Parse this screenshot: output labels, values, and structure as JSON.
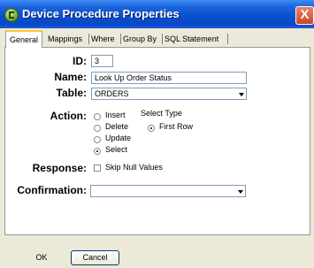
{
  "window": {
    "title": "Device Procedure Properties",
    "close_glyph": "X",
    "titlebar_color": "#0a4fd0",
    "icon": "green-c-icon"
  },
  "tabs": [
    {
      "label": "General",
      "active": true
    },
    {
      "label": "Mappings",
      "active": false
    },
    {
      "label": "Where",
      "active": false
    },
    {
      "label": "Group By",
      "active": false
    },
    {
      "label": "SQL Statement",
      "active": false
    }
  ],
  "form": {
    "id_label": "ID:",
    "id_value": "3",
    "name_label": "Name:",
    "name_value": "Look Up Order Status",
    "table_label": "Table:",
    "table_value": "ORDERS",
    "action_label": "Action:",
    "action_options": [
      "Insert",
      "Delete",
      "Update",
      "Select"
    ],
    "action_selected": "Select",
    "select_type_label": "Select Type",
    "select_type_option": "First Row",
    "response_label": "Response:",
    "skip_null_label": "Skip Null Values",
    "skip_null_checked": false,
    "confirmation_label": "Confirmation:",
    "confirmation_value": ""
  },
  "buttons": {
    "ok": "OK",
    "cancel": "Cancel"
  }
}
